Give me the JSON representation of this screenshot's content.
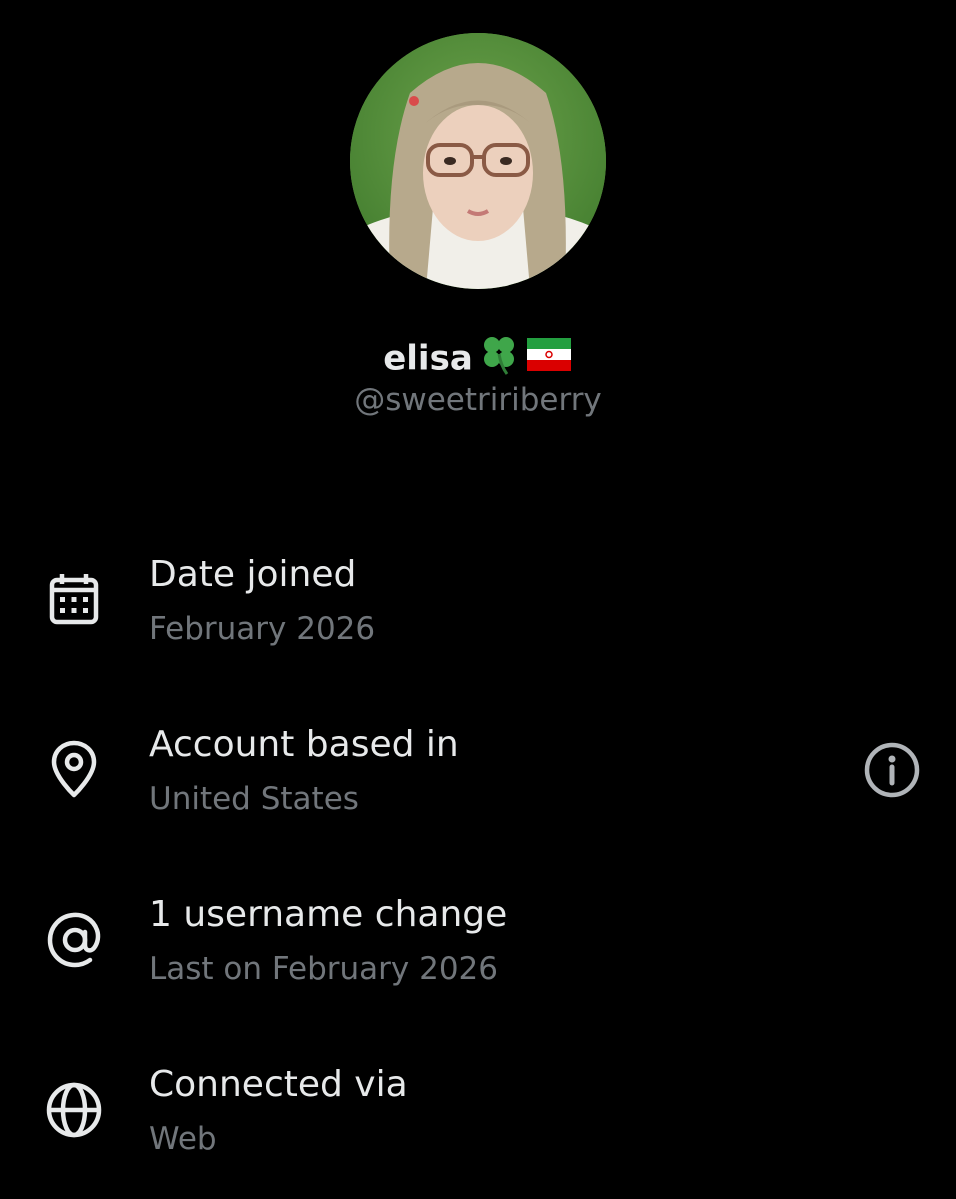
{
  "profile": {
    "display_name": "elisa",
    "name_emoji": [
      "four-leaf-clover",
      "iran-flag"
    ],
    "handle": "@sweetririberry"
  },
  "details": [
    {
      "icon": "calendar-icon",
      "title": "Date joined",
      "value": "February 2026"
    },
    {
      "icon": "location-pin-icon",
      "title": "Account based in",
      "value": "United States",
      "action_icon": "info-icon"
    },
    {
      "icon": "at-sign-icon",
      "title": "1 username change",
      "value": "Last on February 2026"
    },
    {
      "icon": "globe-icon",
      "title": "Connected via",
      "value": "Web"
    }
  ],
  "colors": {
    "background": "#000000",
    "primary_text": "#e7e9ea",
    "secondary_text": "#71767b"
  }
}
